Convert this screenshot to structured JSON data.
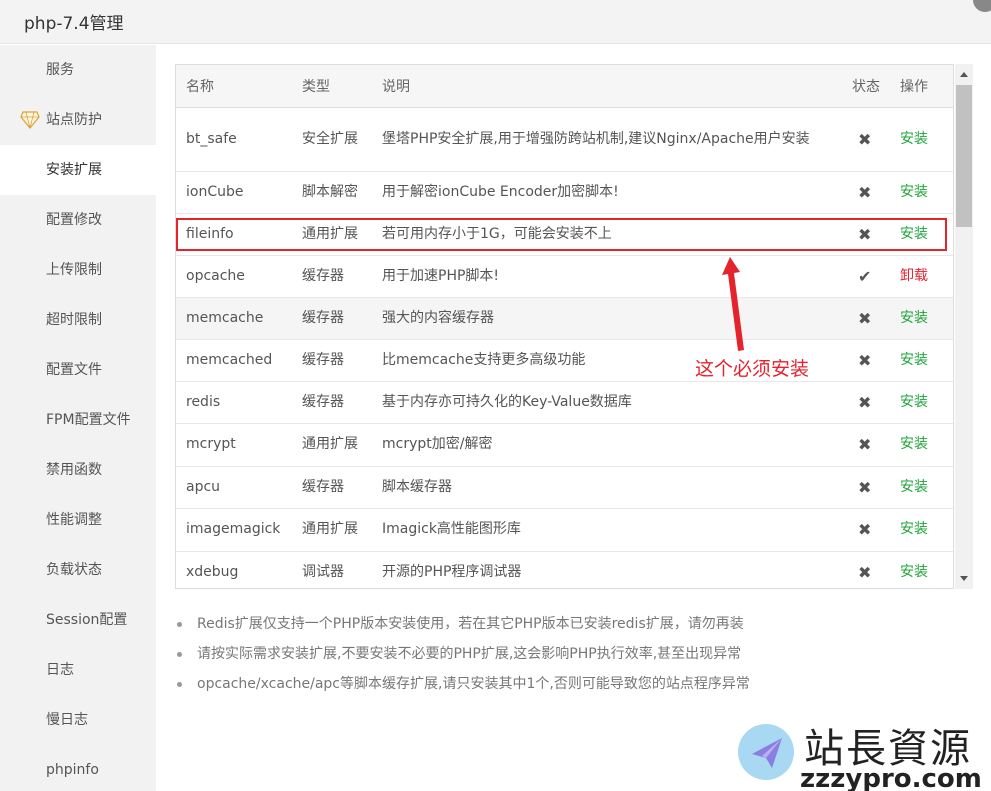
{
  "window": {
    "title": "php-7.4管理"
  },
  "sidebar": {
    "items": [
      {
        "label": "服务",
        "name": "sidebar-item-service"
      },
      {
        "label": "站点防护",
        "name": "sidebar-item-site-protection"
      },
      {
        "label": "安装扩展",
        "name": "sidebar-item-install-extensions"
      },
      {
        "label": "配置修改",
        "name": "sidebar-item-config-edit"
      },
      {
        "label": "上传限制",
        "name": "sidebar-item-upload-limit"
      },
      {
        "label": "超时限制",
        "name": "sidebar-item-timeout-limit"
      },
      {
        "label": "配置文件",
        "name": "sidebar-item-config-file"
      },
      {
        "label": "FPM配置文件",
        "name": "sidebar-item-fpm-config"
      },
      {
        "label": "禁用函数",
        "name": "sidebar-item-disabled-functions"
      },
      {
        "label": "性能调整",
        "name": "sidebar-item-performance"
      },
      {
        "label": "负载状态",
        "name": "sidebar-item-load-status"
      },
      {
        "label": "Session配置",
        "name": "sidebar-item-session"
      },
      {
        "label": "日志",
        "name": "sidebar-item-log"
      },
      {
        "label": "慢日志",
        "name": "sidebar-item-slow-log"
      },
      {
        "label": "phpinfo",
        "name": "sidebar-item-phpinfo"
      }
    ]
  },
  "table": {
    "headers": {
      "name": "名称",
      "type": "类型",
      "desc": "说明",
      "status": "状态",
      "action": "操作"
    },
    "rows": [
      {
        "name": "bt_safe",
        "type": "安全扩展",
        "desc": "堡塔PHP安全扩展,用于增强防跨站机制,建议Nginx/Apache用户安装",
        "status": "✖",
        "action": "安装"
      },
      {
        "name": "ionCube",
        "type": "脚本解密",
        "desc": "用于解密ionCube Encoder加密脚本!",
        "status": "✖",
        "action": "安装"
      },
      {
        "name": "fileinfo",
        "type": "通用扩展",
        "desc": "若可用内存小于1G，可能会安装不上",
        "status": "✖",
        "action": "安装"
      },
      {
        "name": "opcache",
        "type": "缓存器",
        "desc": "用于加速PHP脚本!",
        "status": "✔",
        "action": "卸载"
      },
      {
        "name": "memcache",
        "type": "缓存器",
        "desc": "强大的内容缓存器",
        "status": "✖",
        "action": "安装"
      },
      {
        "name": "memcached",
        "type": "缓存器",
        "desc": "比memcache支持更多高级功能",
        "status": "✖",
        "action": "安装"
      },
      {
        "name": "redis",
        "type": "缓存器",
        "desc": "基于内存亦可持久化的Key-Value数据库",
        "status": "✖",
        "action": "安装"
      },
      {
        "name": "mcrypt",
        "type": "通用扩展",
        "desc": "mcrypt加密/解密",
        "status": "✖",
        "action": "安装"
      },
      {
        "name": "apcu",
        "type": "缓存器",
        "desc": "脚本缓存器",
        "status": "✖",
        "action": "安装"
      },
      {
        "name": "imagemagick",
        "type": "通用扩展",
        "desc": "Imagick高性能图形库",
        "status": "✖",
        "action": "安装"
      },
      {
        "name": "xdebug",
        "type": "调试器",
        "desc": "开源的PHP程序调试器",
        "status": "✖",
        "action": "安装"
      }
    ]
  },
  "annotation": {
    "text": "这个必须安装"
  },
  "tips": [
    "Redis扩展仅支持一个PHP版本安装使用，若在其它PHP版本已安装redis扩展，请勿再装",
    "请按实际需求安装扩展,不要安装不必要的PHP扩展,这会影响PHP执行效率,甚至出现异常",
    "opcache/xcache/apc等脚本缓存扩展,请只安装其中1个,否则可能导致您的站点程序异常"
  ],
  "watermark": {
    "cn": "站長資源",
    "url": "zzzypro.com"
  },
  "colors": {
    "install": "#20a53a",
    "uninstall": "#e5232d",
    "highlight": "#e5232d"
  }
}
